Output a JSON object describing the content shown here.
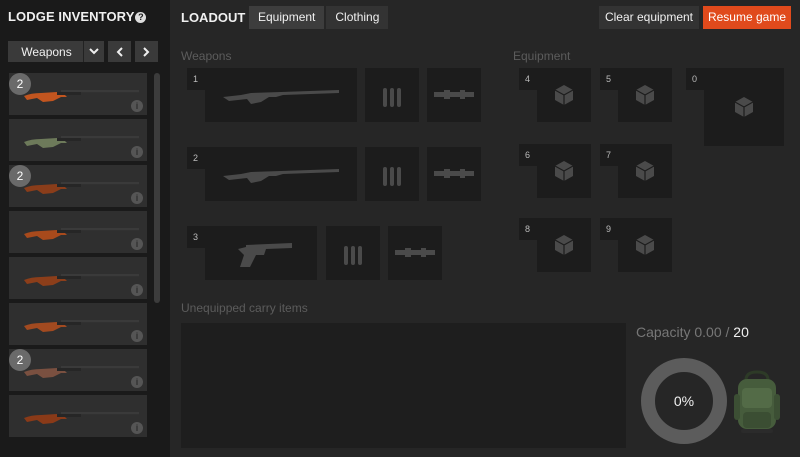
{
  "sidebar": {
    "title": "LODGE INVENTORY",
    "help_glyph": "?",
    "filter": {
      "selected": "Weapons"
    },
    "items": [
      {
        "badge": "2",
        "color": "#c2551f"
      },
      {
        "badge": "",
        "color": "#6d7a5a"
      },
      {
        "badge": "2",
        "color": "#8a3d1a"
      },
      {
        "badge": "",
        "color": "#a84a1c"
      },
      {
        "badge": "",
        "color": "#8c3e1a"
      },
      {
        "badge": "",
        "color": "#a24a20"
      },
      {
        "badge": "2",
        "color": "#7a5040"
      },
      {
        "badge": "",
        "color": "#8a3a18"
      }
    ],
    "info_glyph": "i"
  },
  "header": {
    "title": "LOADOUT",
    "tabs": [
      {
        "label": "Equipment",
        "active": true
      },
      {
        "label": "Clothing",
        "active": false
      }
    ],
    "clear_label": "Clear equipment",
    "resume_label": "Resume game",
    "resume_color": "#e04a1c"
  },
  "weapons": {
    "label": "Weapons",
    "slots": [
      {
        "num": "1",
        "weapon": "rifle-icon"
      },
      {
        "num": "2",
        "weapon": "rifle-icon"
      },
      {
        "num": "3",
        "weapon": "revolver-icon"
      }
    ]
  },
  "equipment": {
    "label": "Equipment",
    "slots": [
      "4",
      "5",
      "0",
      "6",
      "7",
      "8",
      "9"
    ]
  },
  "carry": {
    "label": "Unequipped carry items",
    "capacity_prefix": "Capacity 0.00 /",
    "capacity_max": "20",
    "percent": "0%"
  }
}
